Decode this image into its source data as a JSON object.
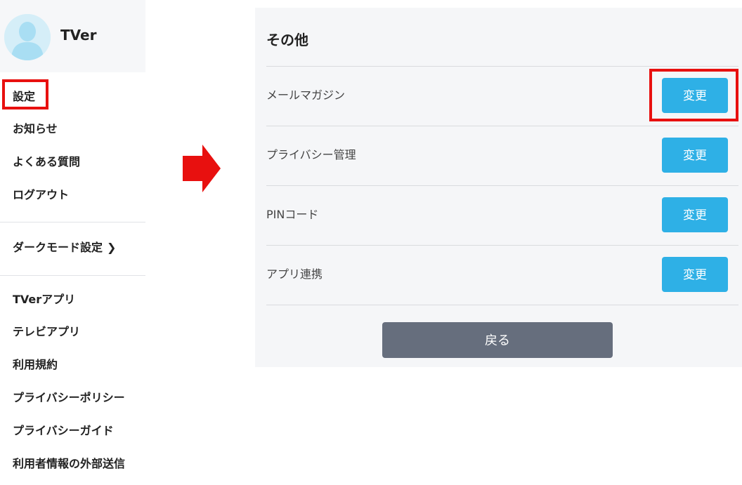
{
  "sidebar": {
    "username": "TVer",
    "menu_group_1": [
      "設定",
      "お知らせ",
      "よくある質問",
      "ログアウト"
    ],
    "dark_mode": {
      "label": "ダークモード設定",
      "chevron": "❯"
    },
    "menu_group_2": [
      "TVerアプリ",
      "テレビアプリ",
      "利用規約",
      "プライバシーポリシー",
      "プライバシーガイド",
      "利用者情報の外部送信"
    ]
  },
  "settings_panel": {
    "title": "その他",
    "rows": [
      {
        "label": "メールマガジン",
        "button": "変更"
      },
      {
        "label": "プライバシー管理",
        "button": "変更"
      },
      {
        "label": "PINコード",
        "button": "変更"
      },
      {
        "label": "アプリ連携",
        "button": "変更"
      }
    ],
    "back_button": "戻る"
  },
  "annotations": {
    "highlight_color": "#e8100f",
    "arrow_color": "#e8100f"
  },
  "colors": {
    "change_button": "#2eb0e6",
    "back_button": "#666e7d",
    "panel_background": "#f5f6f8",
    "avatar_background": "#d5eef8"
  }
}
